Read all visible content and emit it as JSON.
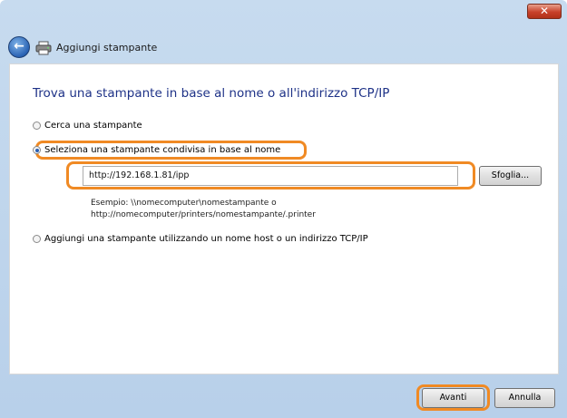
{
  "window": {
    "title": "Aggiungi stampante",
    "close_glyph": "✕",
    "back_glyph": "←"
  },
  "main": {
    "heading": "Trova una stampante in base al nome o all'indirizzo TCP/IP",
    "options": [
      {
        "label": "Cerca una stampante",
        "selected": false
      },
      {
        "label": "Seleziona una stampante condivisa in base al nome",
        "selected": true
      },
      {
        "label": "Aggiungi una stampante utilizzando un nome host o un indirizzo TCP/IP",
        "selected": false
      }
    ],
    "printer_path_value": "http://192.168.1.81/ipp",
    "browse_label": "Sfoglia...",
    "example_line1": "Esempio: \\\\nomecomputer\\nomestampante o",
    "example_line2": "http://nomecomputer/printers/nomestampante/.printer"
  },
  "footer": {
    "next_label": "Avanti",
    "cancel_label": "Annulla"
  },
  "colors": {
    "highlight": "#f08a24",
    "heading": "#1e3287",
    "chrome": "#c7dbef",
    "close_button": "#c8412a"
  }
}
